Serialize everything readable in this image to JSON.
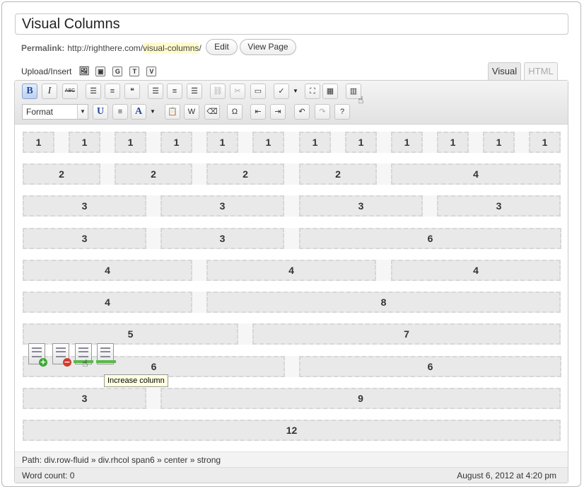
{
  "title_value": "Visual Columns",
  "permalink": {
    "label": "Permalink:",
    "base_url": "http://righthere.com/",
    "slug": "visual-columns",
    "trailing": "/",
    "edit_label": "Edit",
    "view_label": "View Page"
  },
  "upload": {
    "label": "Upload/Insert",
    "icons": [
      "image-icon",
      "media-icon",
      "gallery-icon",
      "text-icon",
      "video-icon"
    ],
    "icon_glyphs": [
      "▣",
      "G",
      "T",
      "V"
    ]
  },
  "tabs": {
    "visual": "Visual",
    "html": "HTML"
  },
  "toolbar": {
    "row1": [
      {
        "name": "bold-button",
        "glyph": "B",
        "cls": "active bold"
      },
      {
        "name": "italic-button",
        "glyph": "I",
        "cls": "ital"
      },
      {
        "name": "strikethrough-button",
        "glyph": "ABC",
        "cls": "small"
      },
      {
        "name": "bullet-list-button",
        "glyph": "☰",
        "cls": "sans"
      },
      {
        "name": "numbered-list-button",
        "glyph": "≡",
        "cls": "sans"
      },
      {
        "name": "blockquote-button",
        "glyph": "❝",
        "cls": "sans"
      },
      {
        "name": "align-left-button",
        "glyph": "☰",
        "cls": "sans"
      },
      {
        "name": "align-center-button",
        "glyph": "≡",
        "cls": "sans"
      },
      {
        "name": "align-right-button",
        "glyph": "☰",
        "cls": "sans"
      },
      {
        "name": "insert-link-button",
        "glyph": "⛓",
        "cls": "sans dis"
      },
      {
        "name": "unlink-button",
        "glyph": "✂",
        "cls": "sans dis"
      },
      {
        "name": "insert-more-button",
        "glyph": "▭",
        "cls": "sans"
      },
      {
        "name": "spellcheck-button",
        "glyph": "✓",
        "cls": "sans"
      },
      {
        "name": "fullscreen-button",
        "glyph": "⛶",
        "cls": "sans"
      },
      {
        "name": "kitchen-sink-button",
        "glyph": "▦",
        "cls": "sans"
      },
      {
        "name": "visual-columns-button",
        "glyph": "▥",
        "cls": "sans"
      }
    ],
    "format_label": "Format",
    "row2": [
      {
        "name": "underline-button",
        "glyph": "U",
        "cls": "bold"
      },
      {
        "name": "justify-button",
        "glyph": "≡",
        "cls": "sans"
      },
      {
        "name": "text-color-button",
        "glyph": "A",
        "cls": "bold"
      },
      {
        "name": "paste-text-button",
        "glyph": "📋",
        "cls": "sans"
      },
      {
        "name": "paste-word-button",
        "glyph": "W",
        "cls": "sans"
      },
      {
        "name": "remove-format-button",
        "glyph": "⌫",
        "cls": "sans"
      },
      {
        "name": "special-char-button",
        "glyph": "Ω",
        "cls": "sans"
      },
      {
        "name": "outdent-button",
        "glyph": "⇤",
        "cls": "sans"
      },
      {
        "name": "indent-button",
        "glyph": "⇥",
        "cls": "sans"
      },
      {
        "name": "undo-button",
        "glyph": "↶",
        "cls": "sans"
      },
      {
        "name": "redo-button",
        "glyph": "↷",
        "cls": "sans dis"
      },
      {
        "name": "help-button",
        "glyph": "?",
        "cls": "sans"
      }
    ]
  },
  "grid_rows": [
    [
      "1",
      "1",
      "1",
      "1",
      "1",
      "1",
      "1",
      "1",
      "1",
      "1",
      "1",
      "1"
    ],
    [
      "2",
      "2",
      "2",
      "2",
      "4"
    ],
    [
      "3",
      "3",
      "3",
      "3"
    ],
    [
      "3",
      "3",
      "6"
    ],
    [
      "4",
      "4",
      "4"
    ],
    [
      "4",
      "8"
    ],
    [
      "5",
      "7"
    ],
    [
      "6",
      "6"
    ],
    [
      "3",
      "9"
    ],
    [
      "12"
    ]
  ],
  "column_tools": {
    "add": "add-column-icon",
    "remove": "remove-column-icon",
    "increase": "increase-column-icon",
    "decrease": "move-column-icon",
    "tooltip": "Increase column"
  },
  "path": {
    "label": "Path:",
    "value": "div.row-fluid » div.rhcol span6 » center » strong"
  },
  "status": {
    "word_count": "Word count: 0",
    "date": "August 6, 2012 at 4:20 pm"
  },
  "colors": {
    "column_fill": "#e9e9e9",
    "column_border": "#d7d7d7",
    "tooltip_bg": "#ffffe1",
    "slug_highlight": "#fffbcc"
  }
}
